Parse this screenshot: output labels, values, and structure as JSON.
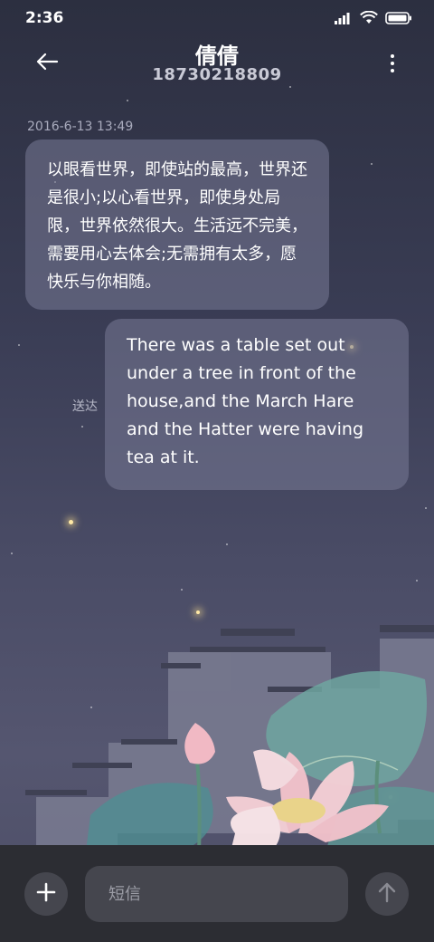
{
  "status_bar": {
    "time": "2:36"
  },
  "header": {
    "contact_name": "倩倩",
    "phone": "18730218809"
  },
  "messages": {
    "timestamp": "2016-6-13 13:49",
    "incoming": "以眼看世界，即使站的最高，世界还是很小;以心看世界，即使身处局限，世界依然很大。生活远不完美，需要用心去体会;无需拥有太多，愿快乐与你相随。",
    "outgoing": "There was a table set out under a tree in front of the house,and the March Hare and the Hatter were having tea at it.",
    "outgoing_status": "送达"
  },
  "composer": {
    "placeholder": "短信"
  }
}
